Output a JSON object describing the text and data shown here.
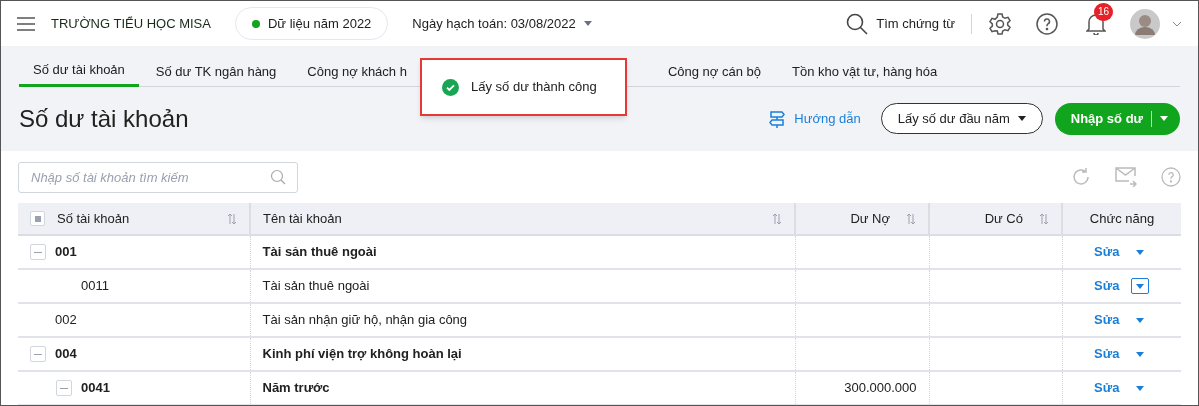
{
  "header": {
    "school": "TRƯỜNG TIỂU HỌC MISA",
    "data_year": "Dữ liệu năm 2022",
    "posting_date": "Ngày hạch toán: 03/08/2022",
    "search": "Tìm chứng từ",
    "notifications": "16"
  },
  "tabs": [
    {
      "label": "Số dư tài khoản",
      "selected": true
    },
    {
      "label": "Số dư TK ngân hàng",
      "selected": false
    },
    {
      "label": "Công nợ khách h",
      "selected": false
    },
    {
      "label": "Công nợ cán bộ",
      "selected": false
    },
    {
      "label": "Tồn kho vật tư, hàng hóa",
      "selected": false
    }
  ],
  "toast": {
    "message": "Lấy số dư thành công"
  },
  "page_title": "Số dư tài khoản",
  "actions": {
    "guide": "Hướng dẫn",
    "fetch": "Lấy số dư đầu năm",
    "primary": "Nhập số dư"
  },
  "search": {
    "placeholder": "Nhập số tài khoản tìm kiếm"
  },
  "table": {
    "select_all": {
      "indeterminate": true
    },
    "columns": [
      "Số tài khoản",
      "Tên tài khoản",
      "Dư Nợ",
      "Dư Có",
      "Chức năng"
    ],
    "rows": [
      {
        "account": "001",
        "name": "Tài sản thuê ngoài",
        "bold": true,
        "expanded": true,
        "action": "Sửa",
        "focused": false,
        "children": [
          {
            "account": "0011",
            "name": "Tài sản thuê ngoài",
            "bold": false,
            "action": "Sửa",
            "focused": true
          }
        ]
      },
      {
        "account": "002",
        "name": "Tài sản nhận giữ hộ, nhận gia công",
        "bold": false,
        "action": "Sửa",
        "focused": false
      },
      {
        "account": "004",
        "name": "Kinh phí viện trợ không hoàn lại",
        "bold": true,
        "expanded": true,
        "action": "Sửa",
        "focused": false,
        "children": [
          {
            "account": "0041",
            "name": "Năm trước",
            "bold": true,
            "expanded": true,
            "debit": "300.000.000",
            "action": "Sửa",
            "focused": false
          }
        ]
      }
    ]
  }
}
